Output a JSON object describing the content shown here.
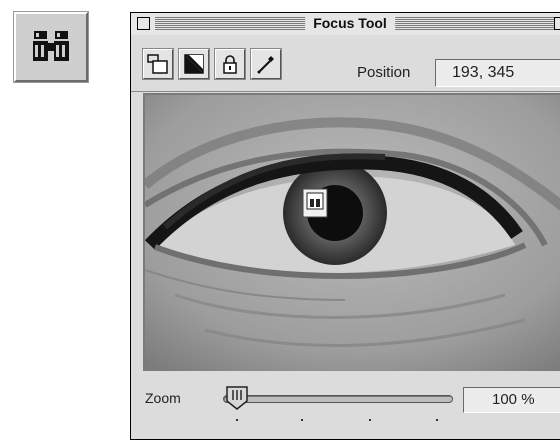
{
  "icon_button": {
    "icon": "binoculars-icon"
  },
  "window": {
    "title": "Focus Tool",
    "controls": {
      "close": "close-box",
      "zoom": "zoom-box"
    }
  },
  "toolbar": {
    "tools": [
      {
        "name": "frame-tool",
        "icon": "frame-icon"
      },
      {
        "name": "mask-tool",
        "icon": "half-fill-icon"
      },
      {
        "name": "lock-tool",
        "icon": "lock-icon"
      },
      {
        "name": "eyedropper-tool",
        "icon": "eyedropper-icon"
      }
    ],
    "position_label": "Position",
    "position_value": "193, 345"
  },
  "image": {
    "subject": "eye",
    "marker_icon": "focus-marker-icon"
  },
  "zoom": {
    "label": "Zoom",
    "value": "100 %",
    "slider_fraction": 0.0
  }
}
